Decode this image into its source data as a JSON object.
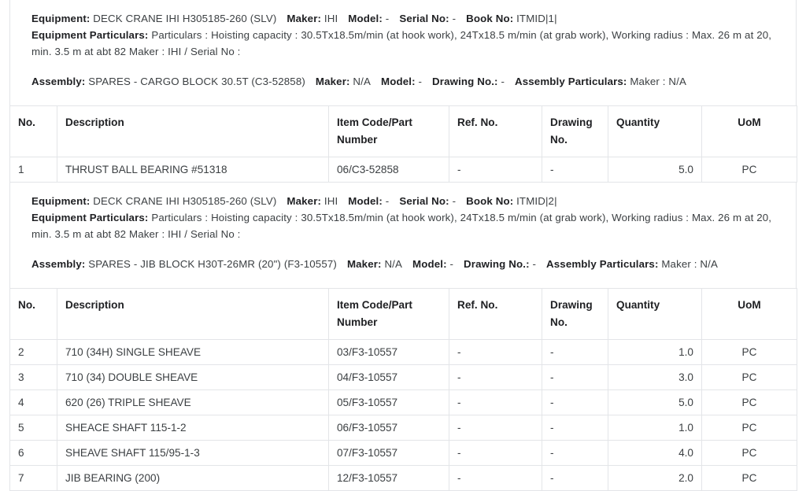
{
  "table_headers": [
    "No.",
    "Description",
    "Item Code/Part Number",
    "Ref. No.",
    "Drawing No.",
    "Quantity",
    "UoM"
  ],
  "header_parts": {
    "no": "No.",
    "description": "Description",
    "item_code_line1": "Item Code/Part",
    "item_code_line2": "Number",
    "ref_no": "Ref. No.",
    "drawing_line1": "Drawing",
    "drawing_line2": "No.",
    "quantity": "Quantity",
    "uom": "UoM"
  },
  "labels": {
    "equipment": "Equipment:",
    "maker": "Maker:",
    "model": "Model:",
    "serial_no": "Serial No:",
    "book_no": "Book No:",
    "equipment_particulars": "Equipment Particulars:",
    "assembly": "Assembly:",
    "drawing_no": "Drawing No.:",
    "assembly_particulars": "Assembly Particulars:"
  },
  "blocks": [
    {
      "equipment": "DECK CRANE IHI H305185-260 (SLV)",
      "maker": "IHI",
      "model": "-",
      "serial_no": "-",
      "book_no": "ITMID|1|",
      "equipment_particulars": "Particulars : Hoisting capacity : 30.5Tx18.5m/min (at hook work), 24Tx18.5 m/min (at grab work), Working radius : Max. 26 m at 20, min. 3.5 m at abt 82 Maker : IHI / Serial No :",
      "assembly": "SPARES - CARGO BLOCK 30.5T (C3-52858)",
      "assembly_maker": "N/A",
      "assembly_model": "-",
      "assembly_drawing_no": "-",
      "assembly_particulars": "Maker : N/A",
      "rows": [
        {
          "no": "1",
          "description": "THRUST BALL BEARING #51318",
          "item_code": "06/C3-52858",
          "ref_no": "-",
          "drawing_no": "-",
          "quantity": "5.0",
          "uom": "PC"
        }
      ]
    },
    {
      "equipment": "DECK CRANE IHI H305185-260 (SLV)",
      "maker": "IHI",
      "model": "-",
      "serial_no": "-",
      "book_no": "ITMID|2|",
      "equipment_particulars": "Particulars : Hoisting capacity : 30.5Tx18.5m/min (at hook work), 24Tx18.5 m/min (at grab work), Working radius : Max. 26 m at 20, min. 3.5 m at abt 82 Maker : IHI / Serial No :",
      "assembly": "SPARES - JIB BLOCK H30T-26MR (20\") (F3-10557)",
      "assembly_maker": "N/A",
      "assembly_model": "-",
      "assembly_drawing_no": "-",
      "assembly_particulars": "Maker : N/A",
      "rows": [
        {
          "no": "2",
          "description": "710 (34H) SINGLE SHEAVE",
          "item_code": "03/F3-10557",
          "ref_no": "-",
          "drawing_no": "-",
          "quantity": "1.0",
          "uom": "PC"
        },
        {
          "no": "3",
          "description": "710 (34) DOUBLE SHEAVE",
          "item_code": "04/F3-10557",
          "ref_no": "-",
          "drawing_no": "-",
          "quantity": "3.0",
          "uom": "PC"
        },
        {
          "no": "4",
          "description": "620 (26) TRIPLE SHEAVE",
          "item_code": "05/F3-10557",
          "ref_no": "-",
          "drawing_no": "-",
          "quantity": "5.0",
          "uom": "PC"
        },
        {
          "no": "5",
          "description": "SHEACE SHAFT 115-1-2",
          "item_code": "06/F3-10557",
          "ref_no": "-",
          "drawing_no": "-",
          "quantity": "1.0",
          "uom": "PC"
        },
        {
          "no": "6",
          "description": "SHEAVE SHAFT 115/95-1-3",
          "item_code": "07/F3-10557",
          "ref_no": "-",
          "drawing_no": "-",
          "quantity": "4.0",
          "uom": "PC"
        },
        {
          "no": "7",
          "description": "JIB BEARING (200)",
          "item_code": "12/F3-10557",
          "ref_no": "-",
          "drawing_no": "-",
          "quantity": "2.0",
          "uom": "PC"
        }
      ]
    }
  ],
  "colors": {
    "border": "#e3e5e8",
    "text": "#3c4043",
    "label": "#202124",
    "background": "#ffffff"
  }
}
